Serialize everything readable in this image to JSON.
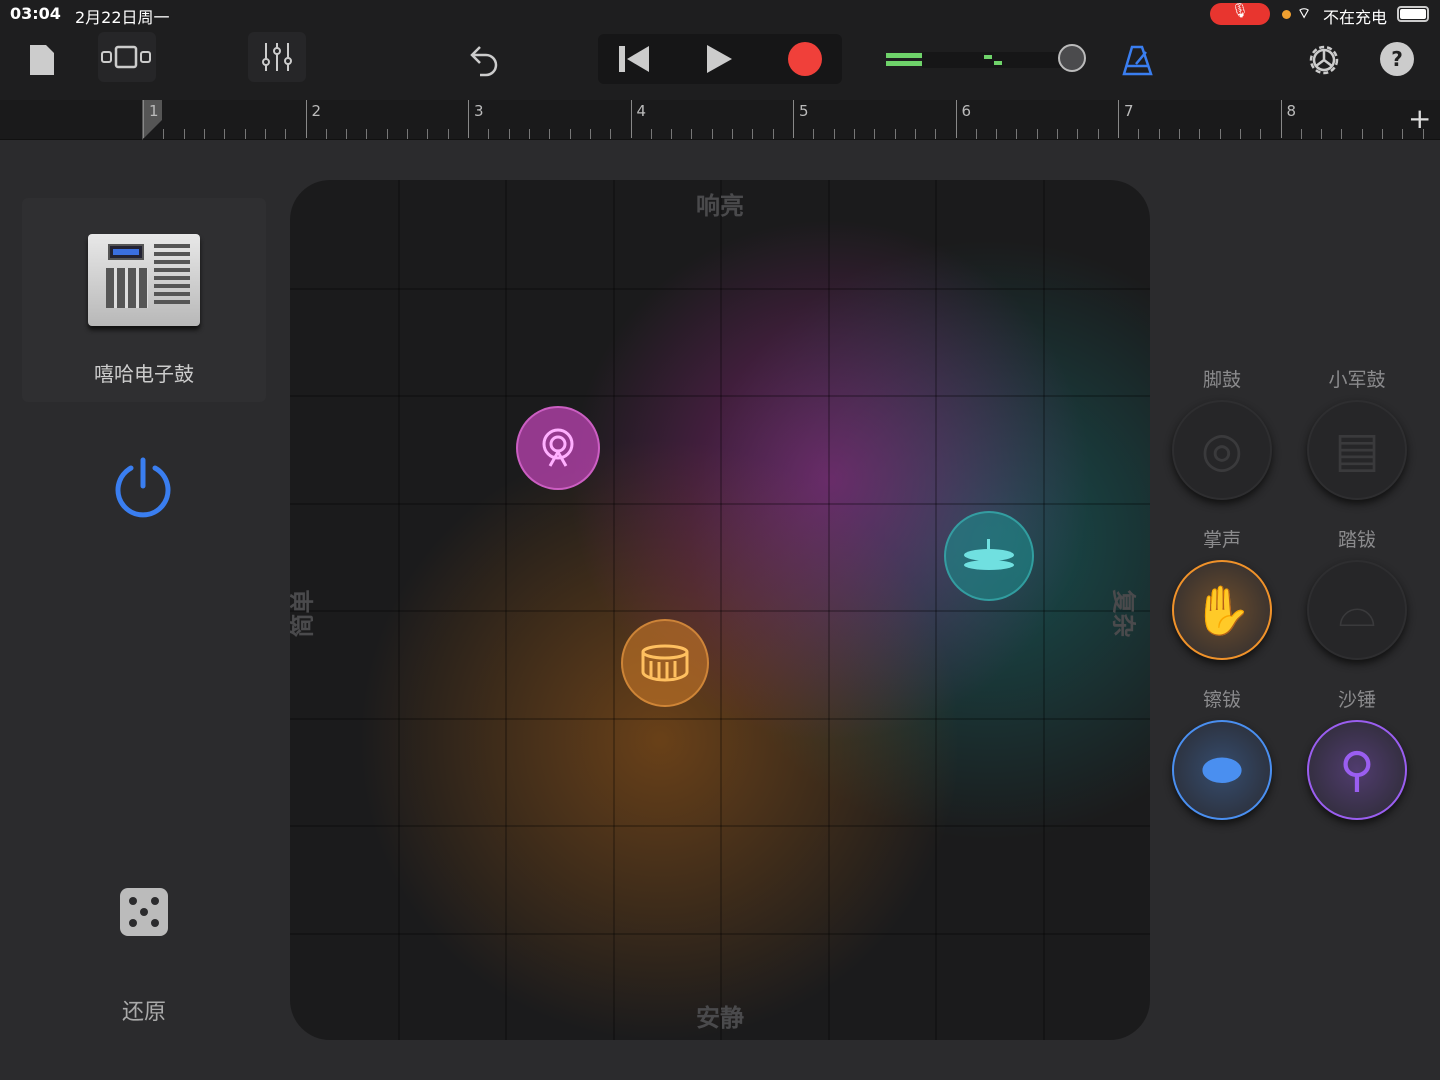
{
  "status_bar": {
    "time": "03:04",
    "date": "2月22日周一",
    "charging": "不在充电"
  },
  "toolbar": {
    "icons": [
      "document-icon",
      "view-toggle-icon",
      "mixer-icon",
      "undo-icon",
      "rewind-icon",
      "play-icon",
      "record-icon",
      "volume-slider",
      "metronome-icon",
      "settings-icon",
      "help-icon"
    ],
    "record_color": "#f0403a",
    "metronome_color": "#3a7ef0"
  },
  "ruler": {
    "bars": [
      "1",
      "2",
      "3",
      "4",
      "5",
      "6",
      "7",
      "8"
    ],
    "add": "+"
  },
  "instrument": {
    "name": "嘻哈电子鼓"
  },
  "left": {
    "reset_label": "还原"
  },
  "pad": {
    "top": "响亮",
    "bottom": "安静",
    "left": "简单",
    "right": "复杂"
  },
  "drums": [
    {
      "label": "脚鼓",
      "active": false,
      "color": "#555"
    },
    {
      "label": "小军鼓",
      "active": false,
      "color": "#555"
    },
    {
      "label": "掌声",
      "active": true,
      "color": "#f0922a"
    },
    {
      "label": "踏钹",
      "active": false,
      "color": "#555"
    },
    {
      "label": "镲钹",
      "active": true,
      "color": "#4a8ff0"
    },
    {
      "label": "沙锤",
      "active": true,
      "color": "#9a5ef0"
    }
  ]
}
